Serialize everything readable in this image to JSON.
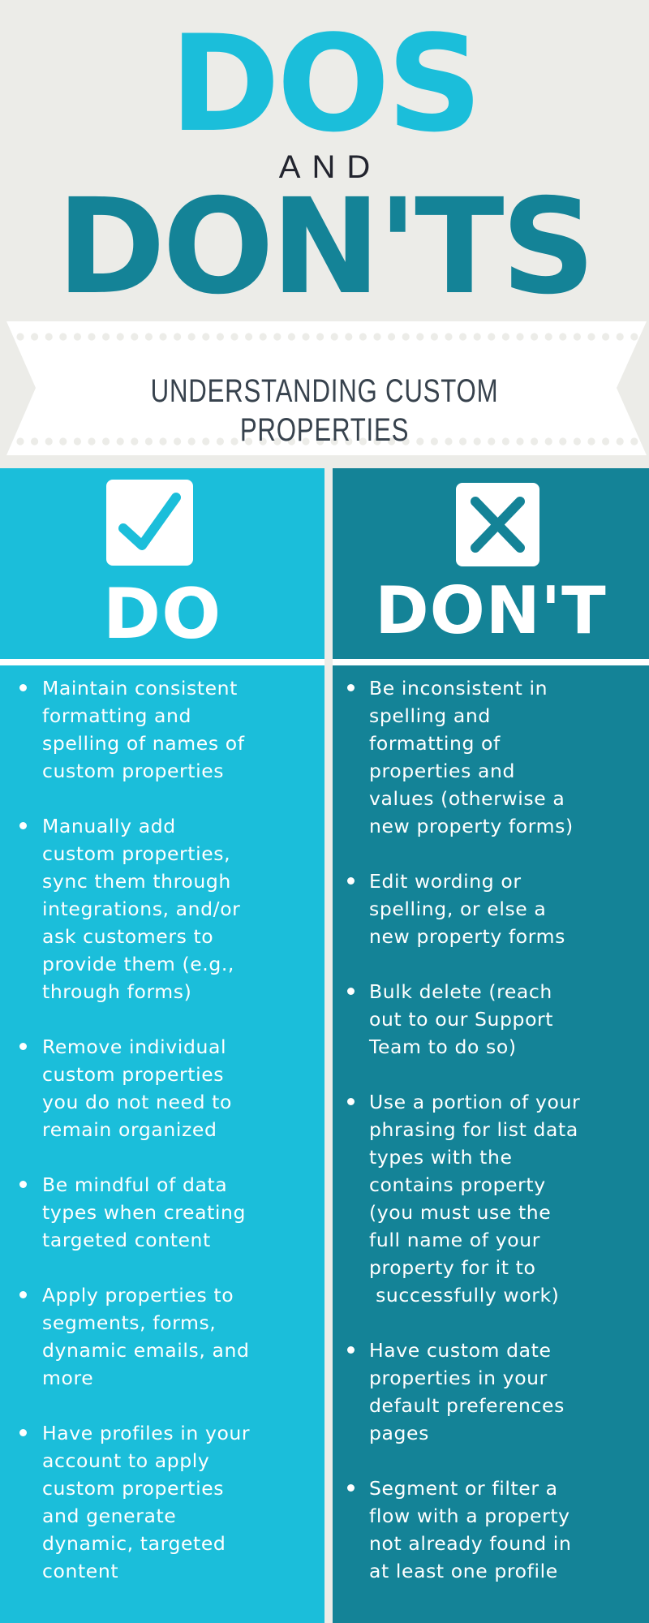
{
  "header": {
    "title_line1": "DOS",
    "title_connector": "AND",
    "title_line2": "DON'TS"
  },
  "banner": {
    "subtitle": "UNDERSTANDING CUSTOM PROPERTIES"
  },
  "colors": {
    "background": "#ECECE8",
    "do_accent": "#1BBEDA",
    "dont_accent": "#148397",
    "connector_text": "#22242E",
    "banner_text": "#37424D"
  },
  "do_column": {
    "icon": "check-box-icon",
    "heading": "DO",
    "items": [
      "Maintain consistent\nformatting and\nspelling of names of\ncustom properties",
      "Manually add\ncustom properties,\nsync them through\nintegrations, and/or\nask customers to\nprovide them (e.g.,\nthrough forms)",
      "Remove individual\ncustom properties\nyou do not need to\nremain organized",
      "Be mindful of data\ntypes when creating\ntargeted content",
      "Apply properties to\nsegments, forms,\ndynamic emails, and\nmore",
      "Have profiles in your\naccount to apply\ncustom properties\nand generate\ndynamic, targeted\ncontent"
    ]
  },
  "dont_column": {
    "icon": "x-box-icon",
    "heading": "DON'T",
    "items": [
      "Be inconsistent in\nspelling and\nformatting of\nproperties and\nvalues (otherwise a\nnew property forms)",
      "Edit wording or\nspelling, or else a\nnew property forms",
      "Bulk delete (reach\nout to our Support\nTeam to do so)",
      "Use a portion of your\nphrasing for list data\ntypes with the\ncontains property\n(you must use the\nfull name of your\nproperty for it to\n successfully work)",
      "Have custom date\nproperties in your\ndefault preferences\npages",
      "Segment or filter a\nflow with a property\nnot already found in\nat least one profile"
    ]
  }
}
